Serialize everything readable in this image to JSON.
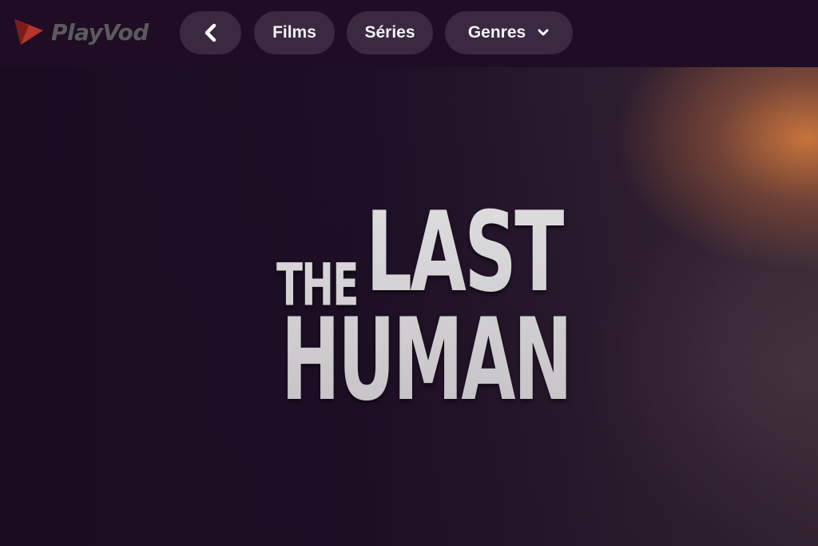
{
  "app": {
    "logo_text": "PlayVod",
    "logo_icon": "play-triangle-icon",
    "accent": "#c0392b"
  },
  "nav": {
    "back_icon": "chevron-left-icon",
    "films_label": "Films",
    "series_label": "Séries",
    "genres_label": "Genres",
    "genres_icon": "chevron-down-icon"
  },
  "hero": {
    "title_line_1a": "THE",
    "title_line_1b": "LAST",
    "title_line_2": "HUMAN"
  }
}
